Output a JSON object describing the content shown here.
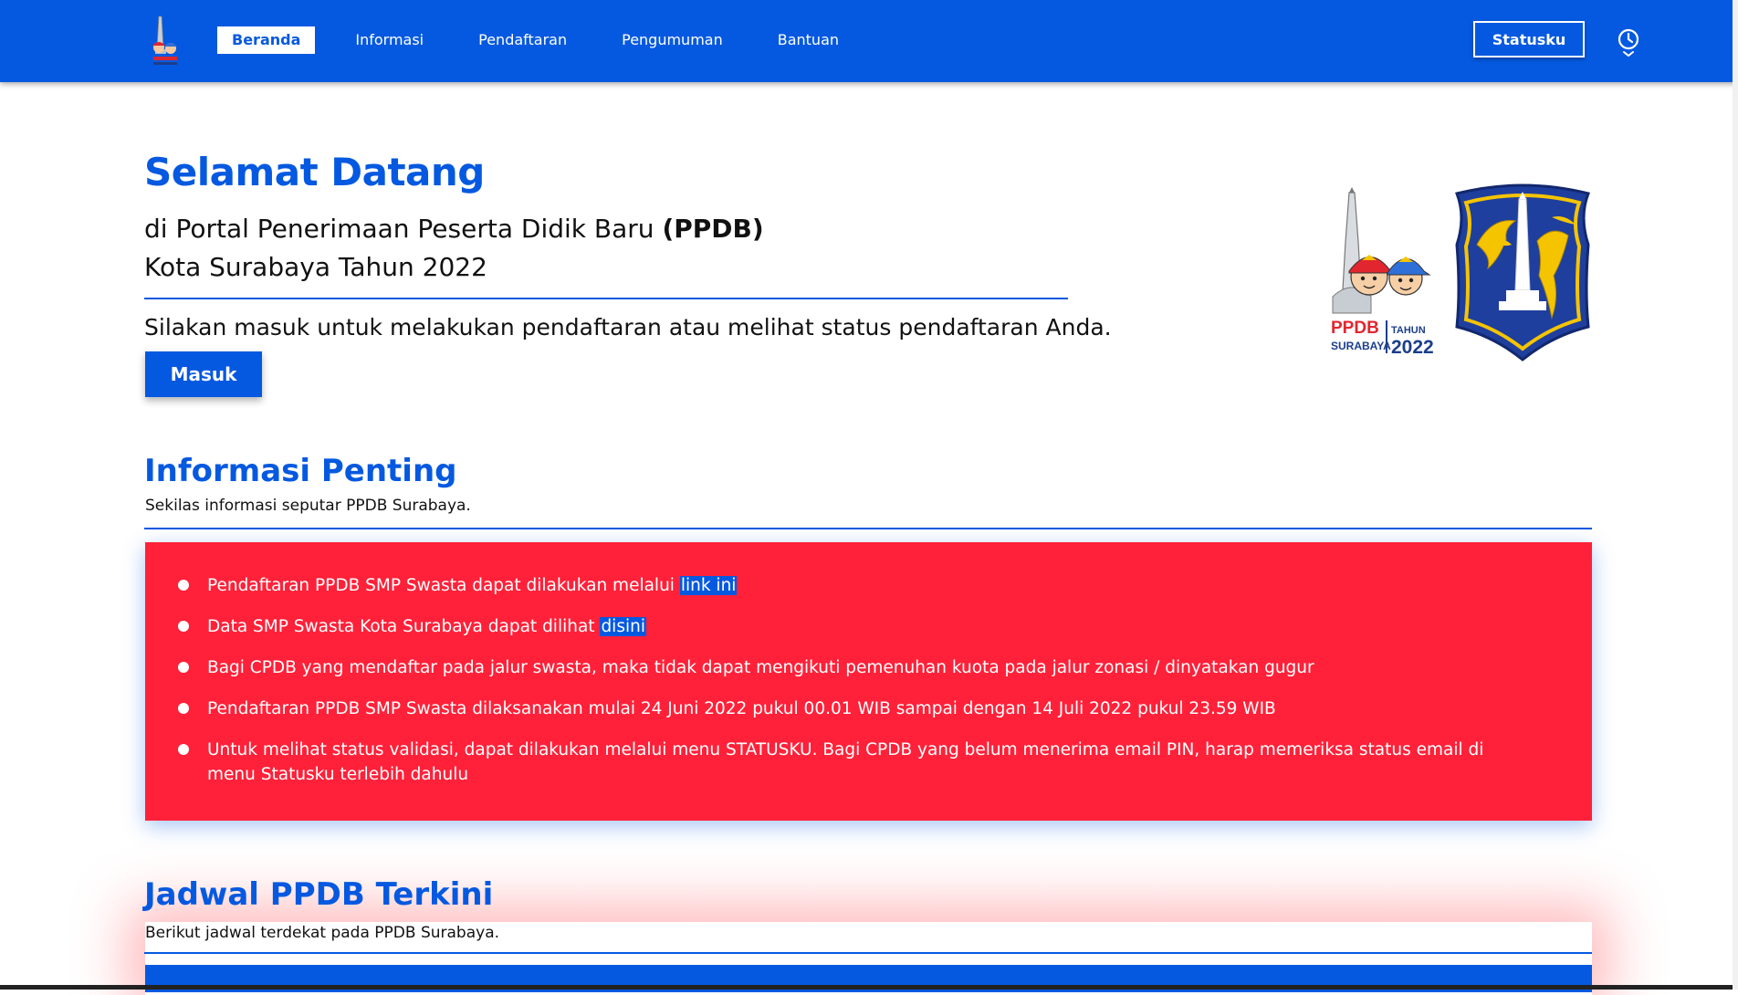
{
  "nav": {
    "items": [
      {
        "label": "Beranda",
        "active": true
      },
      {
        "label": "Informasi",
        "active": false
      },
      {
        "label": "Pendaftaran",
        "active": false
      },
      {
        "label": "Pengumuman",
        "active": false
      },
      {
        "label": "Bantuan",
        "active": false
      }
    ],
    "statusku_label": "Statusku",
    "history_icon": "clock-history-icon"
  },
  "hero": {
    "title": "Selamat Datang",
    "line1_prefix": "di Portal Penerimaan Peserta Didik Baru",
    "line1_bold": "(PPDB)",
    "line2": "Kota Surabaya Tahun 2022",
    "description": "Silakan masuk untuk melakukan pendaftaran atau melihat status pendaftaran Anda.",
    "masuk_label": "Masuk",
    "logo_text": {
      "ppdb": "PPDB",
      "surabaya": "SURABAYA",
      "tahun": "TAHUN",
      "year": "2022"
    }
  },
  "informasi": {
    "title": "Informasi Penting",
    "subtitle": "Sekilas informasi seputar PPDB Surabaya.",
    "items": [
      {
        "text": "Pendaftaran PPDB SMP Swasta dapat dilakukan melalui ",
        "link": "link ini"
      },
      {
        "text": "Data SMP Swasta Kota Surabaya dapat dilihat ",
        "link": "disini"
      },
      {
        "text": "Bagi CPDB yang mendaftar pada jalur swasta, maka tidak dapat mengikuti pemenuhan kuota pada jalur zonasi / dinyatakan gugur",
        "link": ""
      },
      {
        "text": "Pendaftaran PPDB SMP Swasta dilaksanakan mulai 24 Juni 2022 pukul 00.01 WIB sampai dengan 14 Juli 2022 pukul 23.59 WIB",
        "link": ""
      },
      {
        "text": "Untuk melihat status validasi, dapat dilakukan melalui menu STATUSKU. Bagi CPDB yang belum menerima email PIN, harap memeriksa status email di menu Statusku terlebih dahulu",
        "link": ""
      }
    ]
  },
  "jadwal": {
    "title": "Jadwal PPDB Terkini",
    "subtitle": "Berikut jadwal terdekat pada PPDB Surabaya."
  },
  "colors": {
    "primary": "#0559e0",
    "alert": "#ff2139",
    "white": "#ffffff"
  }
}
